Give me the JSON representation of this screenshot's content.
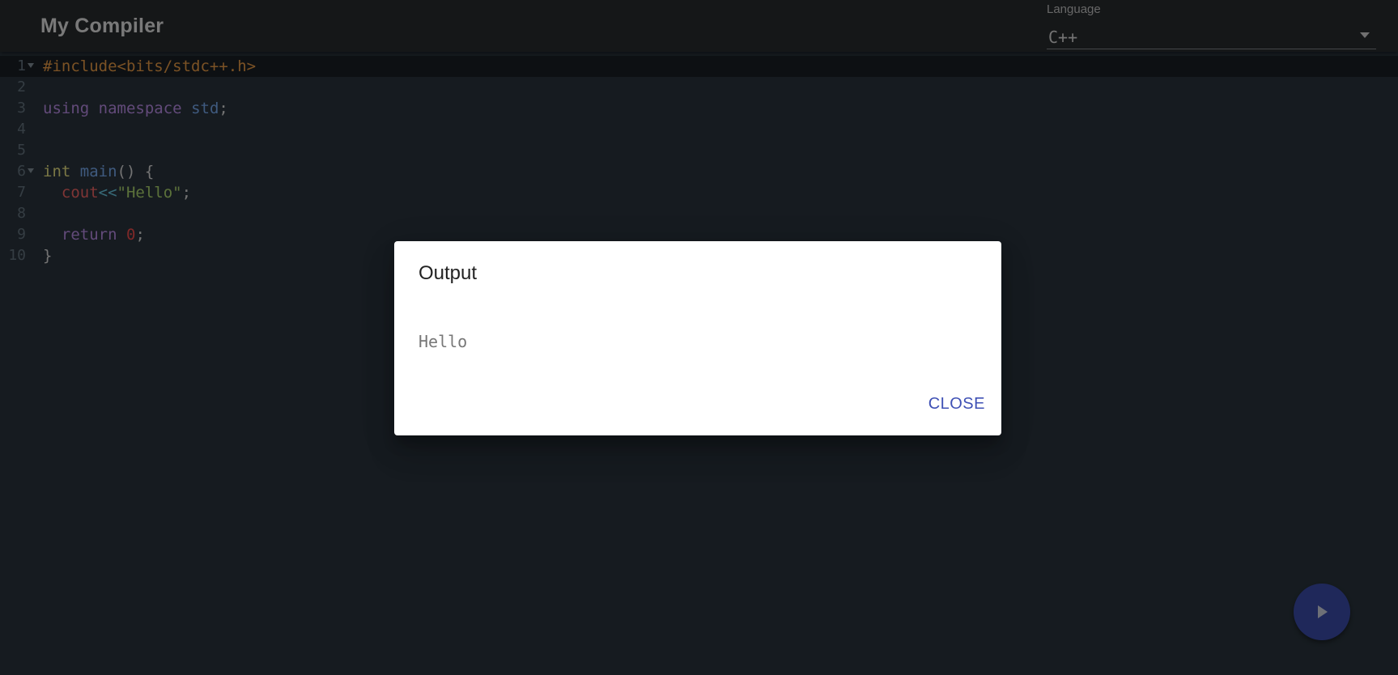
{
  "header": {
    "title": "My Compiler",
    "language_label": "Language",
    "language_value": "C++"
  },
  "editor": {
    "lines": [
      {
        "num": "1",
        "fold": true,
        "tokens": [
          {
            "t": "pre",
            "v": "#include<bits/stdc++.h>"
          }
        ]
      },
      {
        "num": "2",
        "fold": false,
        "tokens": []
      },
      {
        "num": "3",
        "fold": false,
        "tokens": [
          {
            "t": "kw",
            "v": "using"
          },
          {
            "t": "punc",
            "v": " "
          },
          {
            "t": "kw",
            "v": "namespace"
          },
          {
            "t": "punc",
            "v": " "
          },
          {
            "t": "id",
            "v": "std"
          },
          {
            "t": "punc",
            "v": ";"
          }
        ]
      },
      {
        "num": "4",
        "fold": false,
        "tokens": []
      },
      {
        "num": "5",
        "fold": false,
        "tokens": []
      },
      {
        "num": "6",
        "fold": true,
        "tokens": [
          {
            "t": "type",
            "v": "int"
          },
          {
            "t": "punc",
            "v": " "
          },
          {
            "t": "fn",
            "v": "main"
          },
          {
            "t": "punc",
            "v": "() {"
          }
        ]
      },
      {
        "num": "7",
        "fold": false,
        "tokens": [
          {
            "t": "punc",
            "v": "  "
          },
          {
            "t": "obj",
            "v": "cout"
          },
          {
            "t": "op",
            "v": "<<"
          },
          {
            "t": "str",
            "v": "\"Hello\""
          },
          {
            "t": "punc",
            "v": ";"
          }
        ]
      },
      {
        "num": "8",
        "fold": false,
        "tokens": []
      },
      {
        "num": "9",
        "fold": false,
        "tokens": [
          {
            "t": "punc",
            "v": "  "
          },
          {
            "t": "kw",
            "v": "return"
          },
          {
            "t": "punc",
            "v": " "
          },
          {
            "t": "num",
            "v": "0"
          },
          {
            "t": "punc",
            "v": ";"
          }
        ]
      },
      {
        "num": "10",
        "fold": false,
        "tokens": [
          {
            "t": "punc",
            "v": "}"
          }
        ]
      }
    ]
  },
  "dialog": {
    "title": "Output",
    "output": "Hello",
    "close_label": "CLOSE"
  },
  "fab": {
    "icon": "play-icon"
  },
  "colors": {
    "accent": "#3f51b5"
  }
}
